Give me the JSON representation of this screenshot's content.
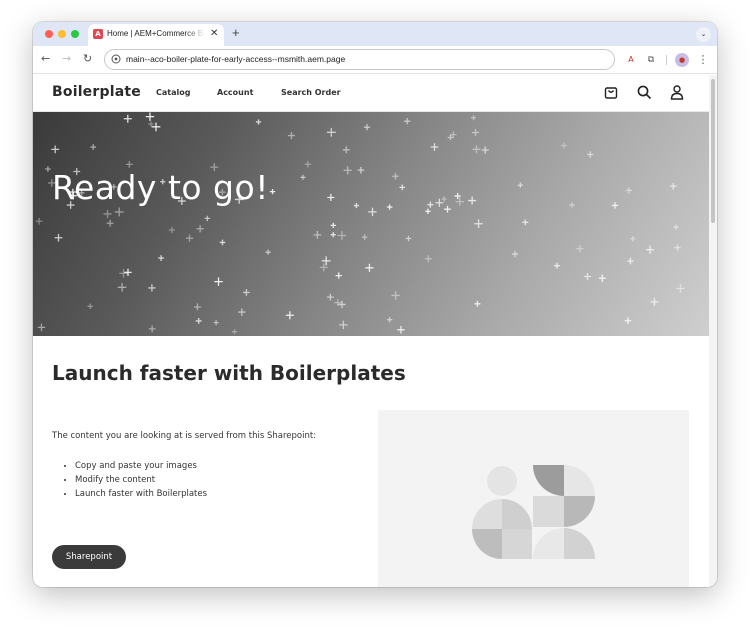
{
  "browser": {
    "tab": {
      "title": "Home | AEM+Commerce Boilerplate",
      "favicon_glyph": "A"
    },
    "new_tab_glyph": "+",
    "close_glyph": "✕",
    "url": "main--aco-boiler-plate-for-early-access--msmith.aem.page"
  },
  "site": {
    "brand": "Boilerplate",
    "nav": [
      "Catalog",
      "Account",
      "Search Order"
    ],
    "icons": [
      "cart-icon",
      "search-icon",
      "user-icon"
    ]
  },
  "hero": {
    "title": "Ready to go!"
  },
  "section": {
    "title": "Launch faster with Boilerplates",
    "intro": "The content you are looking at is served from this Sharepoint:",
    "bullets": [
      "Copy and paste your images",
      "Modify the content",
      "Launch faster with Boilerplates"
    ],
    "cta_label": "Sharepoint"
  },
  "colors": {
    "accent_dark": "#3b3b3b",
    "illustration_bg": "#f3f3f3"
  }
}
